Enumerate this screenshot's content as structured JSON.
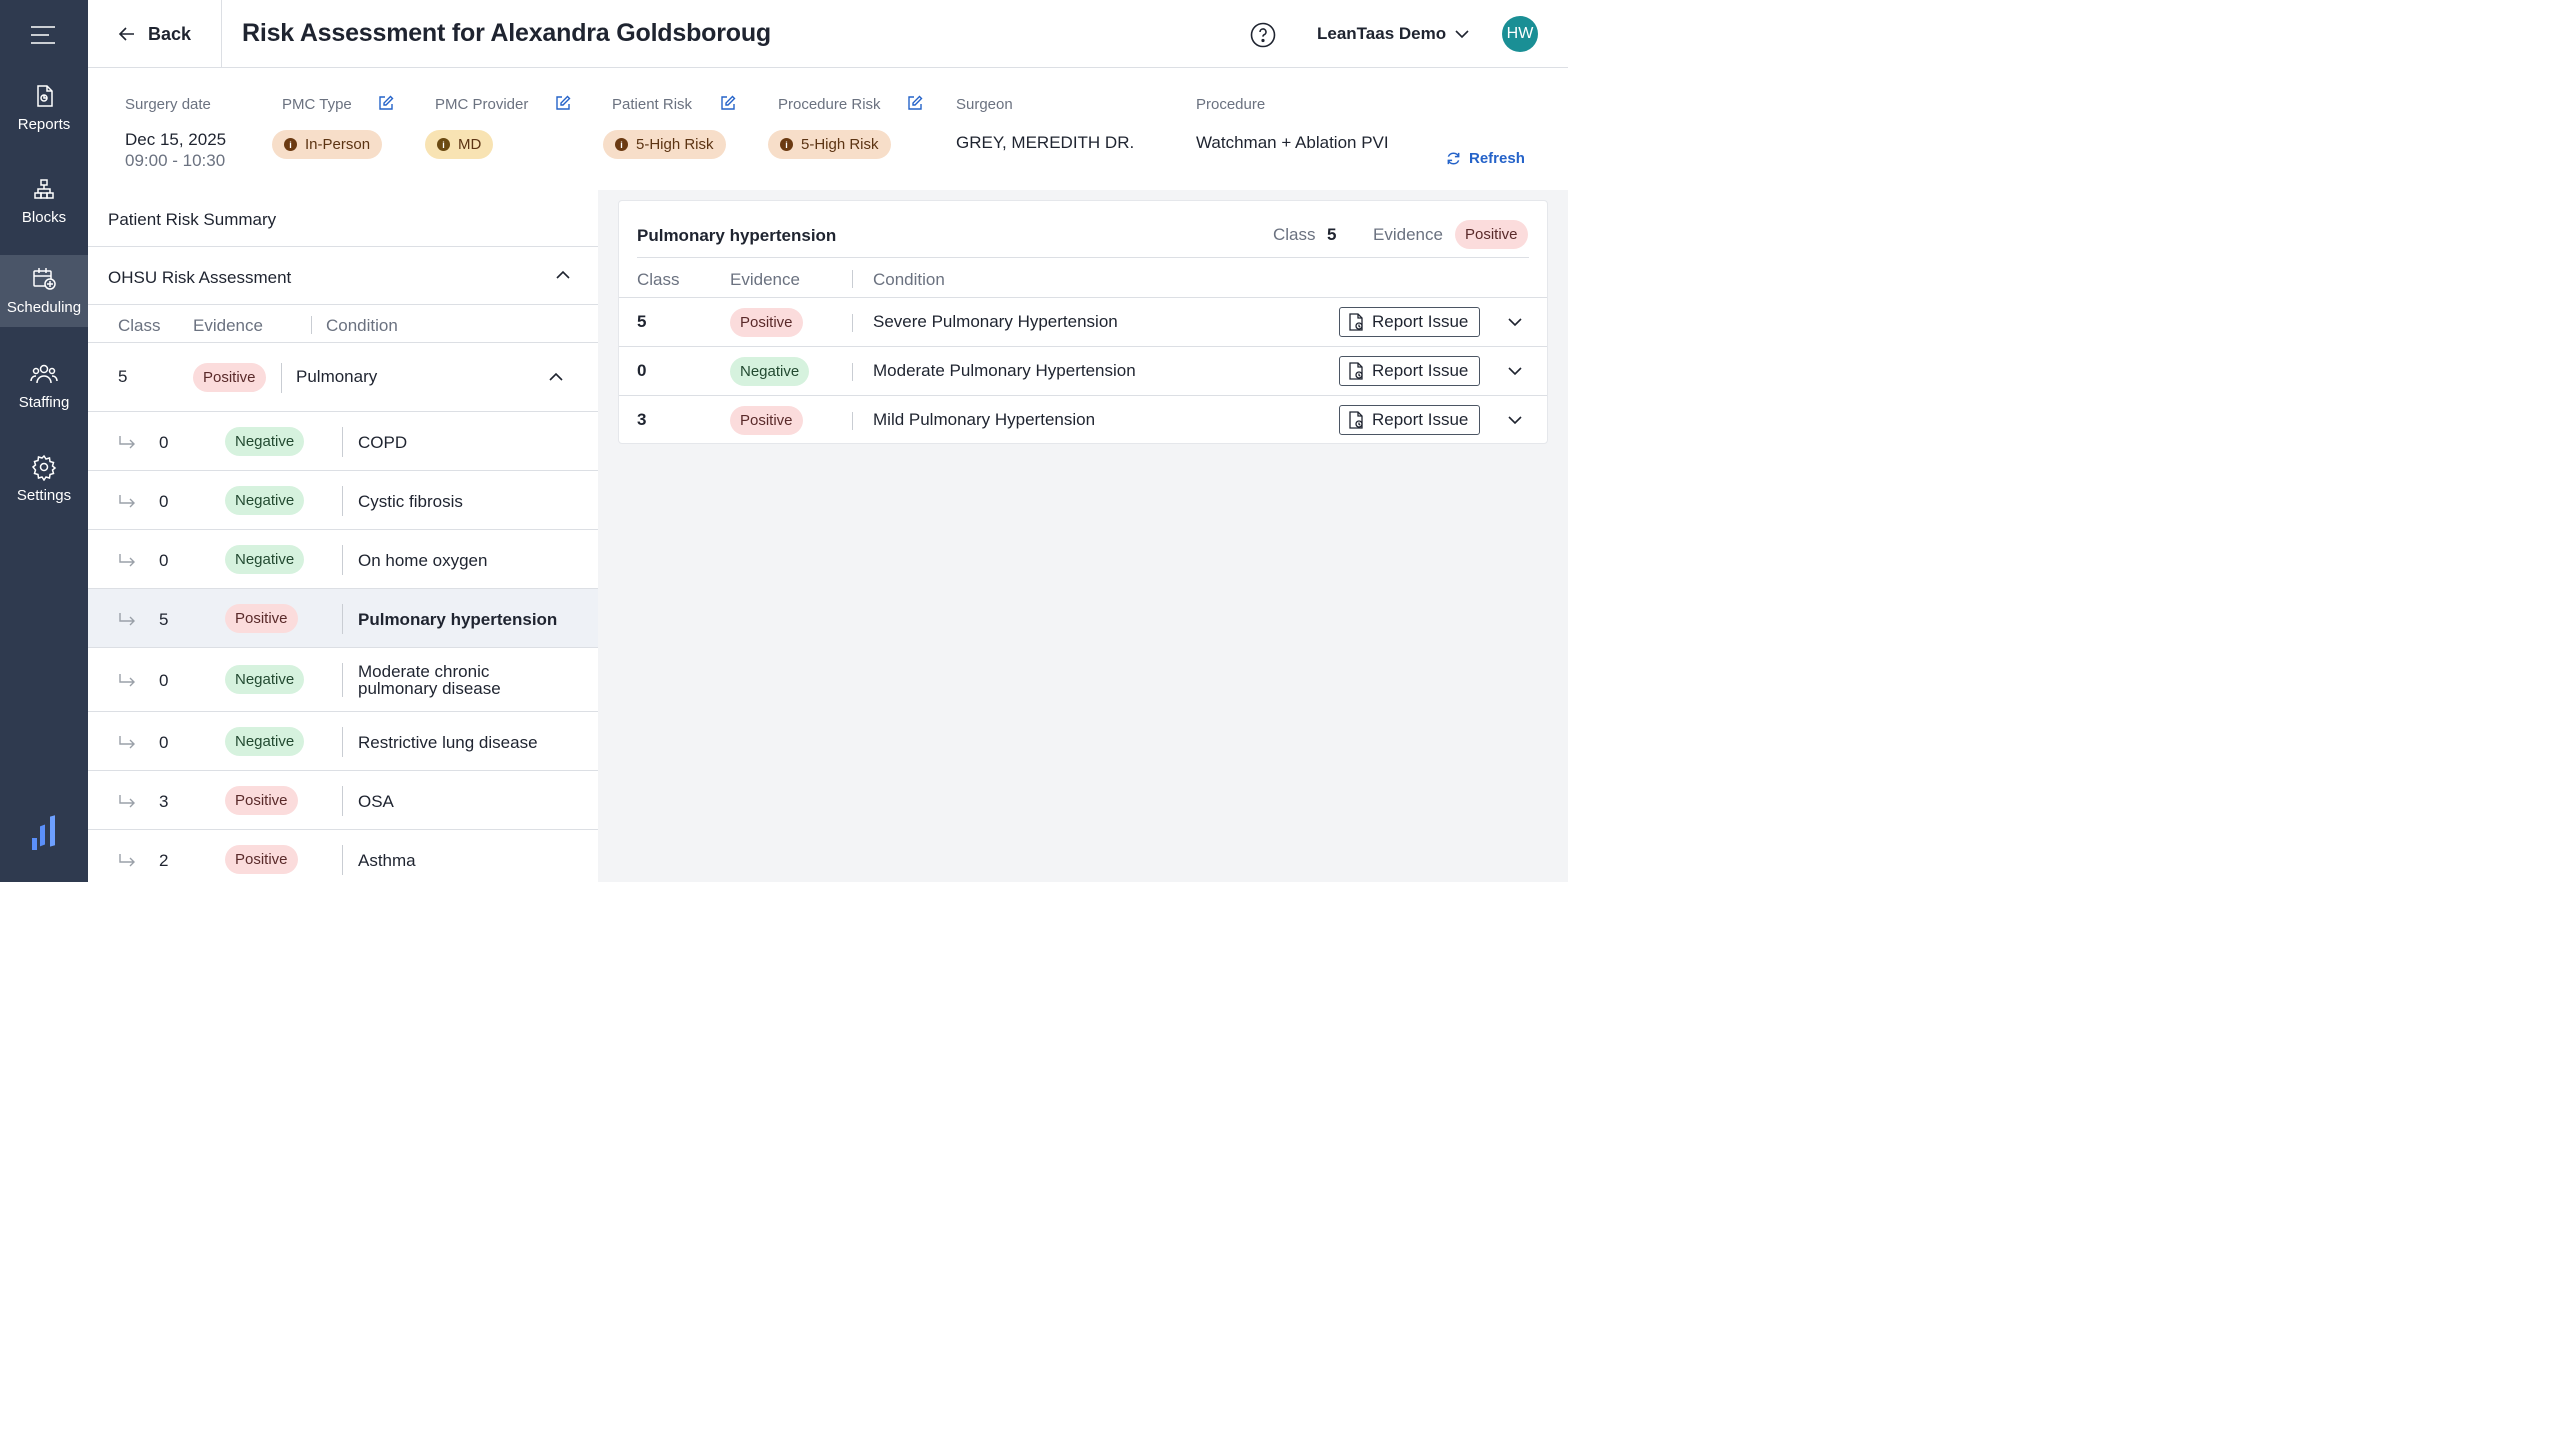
{
  "sidebar": {
    "items": [
      {
        "label": "Reports",
        "icon": "report-icon"
      },
      {
        "label": "Blocks",
        "icon": "blocks-icon"
      },
      {
        "label": "Scheduling",
        "icon": "calendar-add-icon",
        "active": true
      },
      {
        "label": "Staffing",
        "icon": "people-icon"
      },
      {
        "label": "Settings",
        "icon": "gear-icon"
      }
    ]
  },
  "header": {
    "back_label": "Back",
    "title": "Risk Assessment for Alexandra Goldsboroug",
    "org_name": "LeanTaas Demo",
    "avatar_initials": "HW"
  },
  "info": {
    "surgery_date_label": "Surgery date",
    "surgery_date": "Dec 15, 2025",
    "surgery_time": "09:00 - 10:30",
    "pmc_type_label": "PMC Type",
    "pmc_type": "In-Person",
    "pmc_provider_label": "PMC Provider",
    "pmc_provider": "MD",
    "patient_risk_label": "Patient Risk",
    "patient_risk": "5-High Risk",
    "procedure_risk_label": "Procedure Risk",
    "procedure_risk": "5-High Risk",
    "surgeon_label": "Surgeon",
    "surgeon": "GREY, MEREDITH DR.",
    "procedure_label": "Procedure",
    "procedure": "Watchman + Ablation PVI",
    "refresh_label": "Refresh"
  },
  "summary": {
    "title": "Patient Risk Summary",
    "section_title": "OHSU Risk Assessment",
    "columns": {
      "class": "Class",
      "evidence": "Evidence",
      "condition": "Condition"
    },
    "group": {
      "class": "5",
      "evidence": "Positive",
      "condition": "Pulmonary"
    },
    "rows": [
      {
        "class": "0",
        "evidence": "Negative",
        "condition": "COPD"
      },
      {
        "class": "0",
        "evidence": "Negative",
        "condition": "Cystic fibrosis"
      },
      {
        "class": "0",
        "evidence": "Negative",
        "condition": "On home oxygen"
      },
      {
        "class": "5",
        "evidence": "Positive",
        "condition": "Pulmonary hypertension"
      },
      {
        "class": "0",
        "evidence": "Negative",
        "condition": "Moderate chronic pulmonary disease"
      },
      {
        "class": "0",
        "evidence": "Negative",
        "condition": "Restrictive lung disease"
      },
      {
        "class": "3",
        "evidence": "Positive",
        "condition": "OSA"
      },
      {
        "class": "2",
        "evidence": "Positive",
        "condition": "Asthma"
      }
    ]
  },
  "detail": {
    "title": "Pulmonary hypertension",
    "class_label": "Class",
    "class_value": "5",
    "evidence_label": "Evidence",
    "evidence_value": "Positive",
    "columns": {
      "class": "Class",
      "evidence": "Evidence",
      "condition": "Condition"
    },
    "report_label": "Report Issue",
    "rows": [
      {
        "class": "5",
        "evidence": "Positive",
        "condition": "Severe Pulmonary Hypertension"
      },
      {
        "class": "0",
        "evidence": "Negative",
        "condition": "Moderate Pulmonary Hypertension"
      },
      {
        "class": "3",
        "evidence": "Positive",
        "condition": "Mild Pulmonary Hypertension"
      }
    ]
  },
  "colors": {
    "sidebar": "#2f3a4f",
    "accent": "#2563c9",
    "positive_bg": "#fbdcdc",
    "negative_bg": "#d6f2de",
    "risk_bg": "#f7dec9",
    "avatar": "#1a8f95"
  }
}
